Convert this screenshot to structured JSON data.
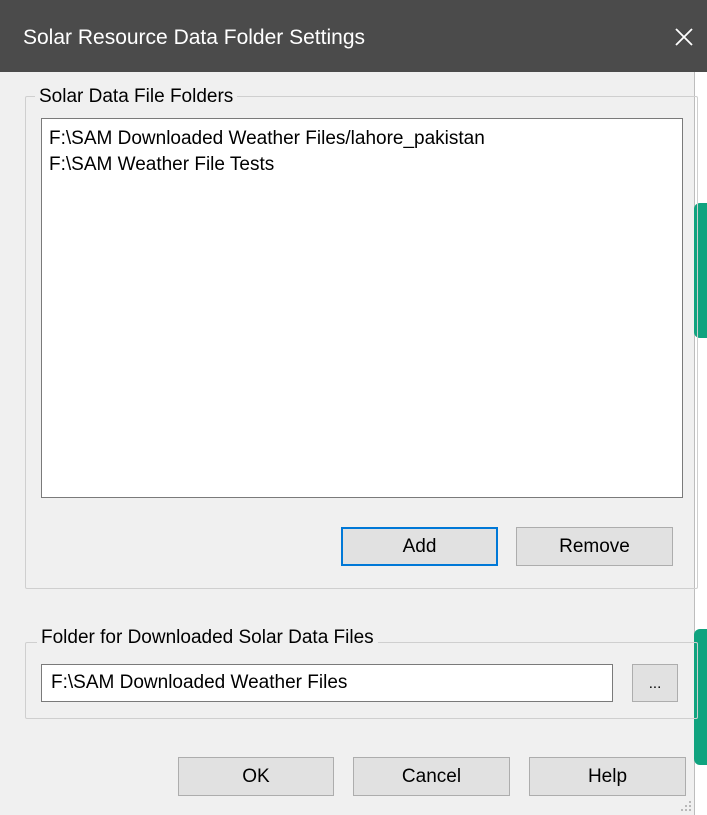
{
  "dialog": {
    "title": "Solar Resource Data Folder Settings",
    "close_icon": "close-icon"
  },
  "folders_group": {
    "legend": "Solar Data File Folders",
    "items": [
      "F:\\SAM Downloaded Weather Files/lahore_pakistan",
      "F:\\SAM Weather File Tests"
    ],
    "add_label": "Add",
    "remove_label": "Remove"
  },
  "download_group": {
    "legend": "Folder for Downloaded Solar Data Files",
    "path_value": "F:\\SAM Downloaded Weather Files",
    "browse_label": "..."
  },
  "footer": {
    "ok_label": "OK",
    "cancel_label": "Cancel",
    "help_label": "Help"
  },
  "colors": {
    "titlebar": "#4b4b4b",
    "accent": "#10a37f",
    "default_button_border": "#0078d7"
  }
}
